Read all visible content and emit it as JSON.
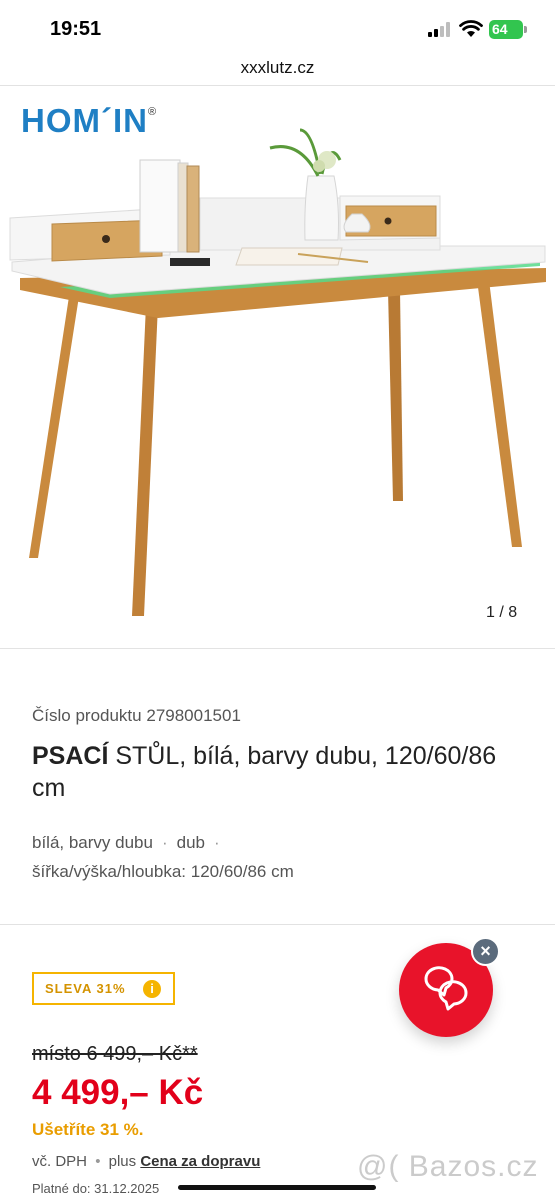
{
  "status_bar": {
    "time": "19:51",
    "battery_level": "64",
    "battery_color": "#32c54f"
  },
  "browser": {
    "url": "xxxlutz.cz"
  },
  "gallery": {
    "brand_name": "HOM´IN",
    "brand_mark": "®",
    "counter": "1 / 8"
  },
  "product": {
    "number_label": "Číslo produktu",
    "number": "2798001501",
    "title_bold": "PSACÍ",
    "title_rest": " STŮL, bílá, barvy dubu, 120/60/86 cm",
    "attr_color": "bílá, barvy dubu",
    "attr_material": "dub",
    "attr_separator": "·",
    "dimensions": "šířka/výška/hloubka: 120/60/86 cm"
  },
  "pricing": {
    "discount_label": "SLEVA 31%",
    "info_icon": "i",
    "old_price": "místo 6 499,– Kč**",
    "new_price": "4 499,– Kč",
    "savings": "Ušetříte 31 %.",
    "tax_note": "vč. DPH",
    "bullet": "•",
    "shipping_prefix": "plus",
    "shipping_link": "Cena za dopravu",
    "valid_until": "Platné do: 31.12.2025"
  },
  "chat": {
    "close_glyph": "×",
    "accent": "#e8132a"
  },
  "watermark": "@( Bazos.cz",
  "colors": {
    "brand_blue": "#1f7fc4",
    "price_red": "#e2001a",
    "discount_yellow": "#f5b400"
  }
}
